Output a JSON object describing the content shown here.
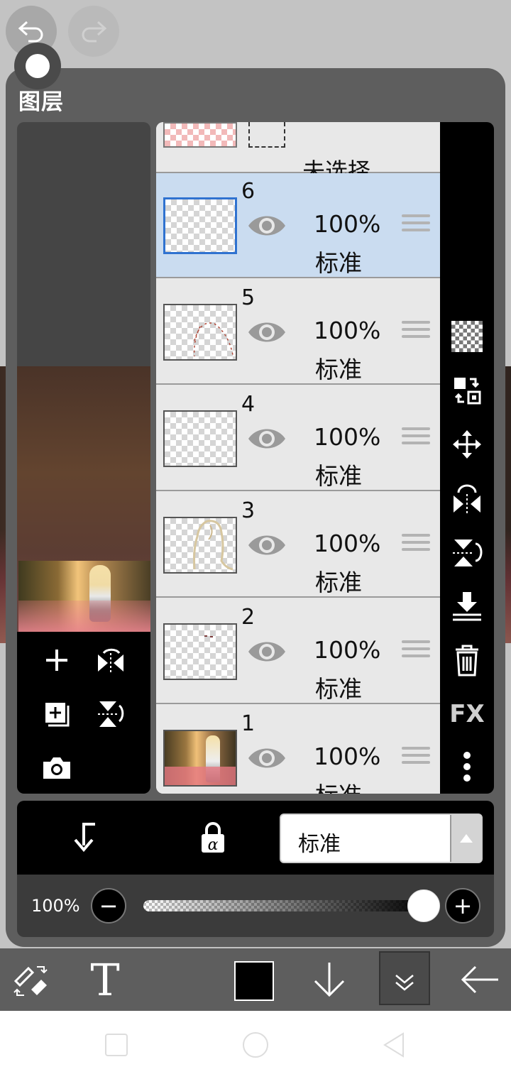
{
  "panel": {
    "title": "图层"
  },
  "layers_header": {
    "label": "未选择"
  },
  "layers": [
    {
      "number": "6",
      "opacity": "100%",
      "mode": "标准",
      "selected": true
    },
    {
      "number": "5",
      "opacity": "100%",
      "mode": "标准",
      "selected": false
    },
    {
      "number": "4",
      "opacity": "100%",
      "mode": "标准",
      "selected": false
    },
    {
      "number": "3",
      "opacity": "100%",
      "mode": "标准",
      "selected": false
    },
    {
      "number": "2",
      "opacity": "100%",
      "mode": "标准",
      "selected": false
    },
    {
      "number": "1",
      "opacity": "100%",
      "mode": "标准",
      "selected": false
    }
  ],
  "side_tools": {
    "fx_label": "FX"
  },
  "blend": {
    "selected": "标准"
  },
  "opacity": {
    "label": "100%",
    "value": 1.0,
    "minus": "−",
    "plus": "+"
  },
  "toolbar": {
    "text_tool_label": "T"
  },
  "colors": {
    "accent": "#2f72d0",
    "selected_row": "#cadcf0",
    "panel": "#5e5e5e"
  }
}
